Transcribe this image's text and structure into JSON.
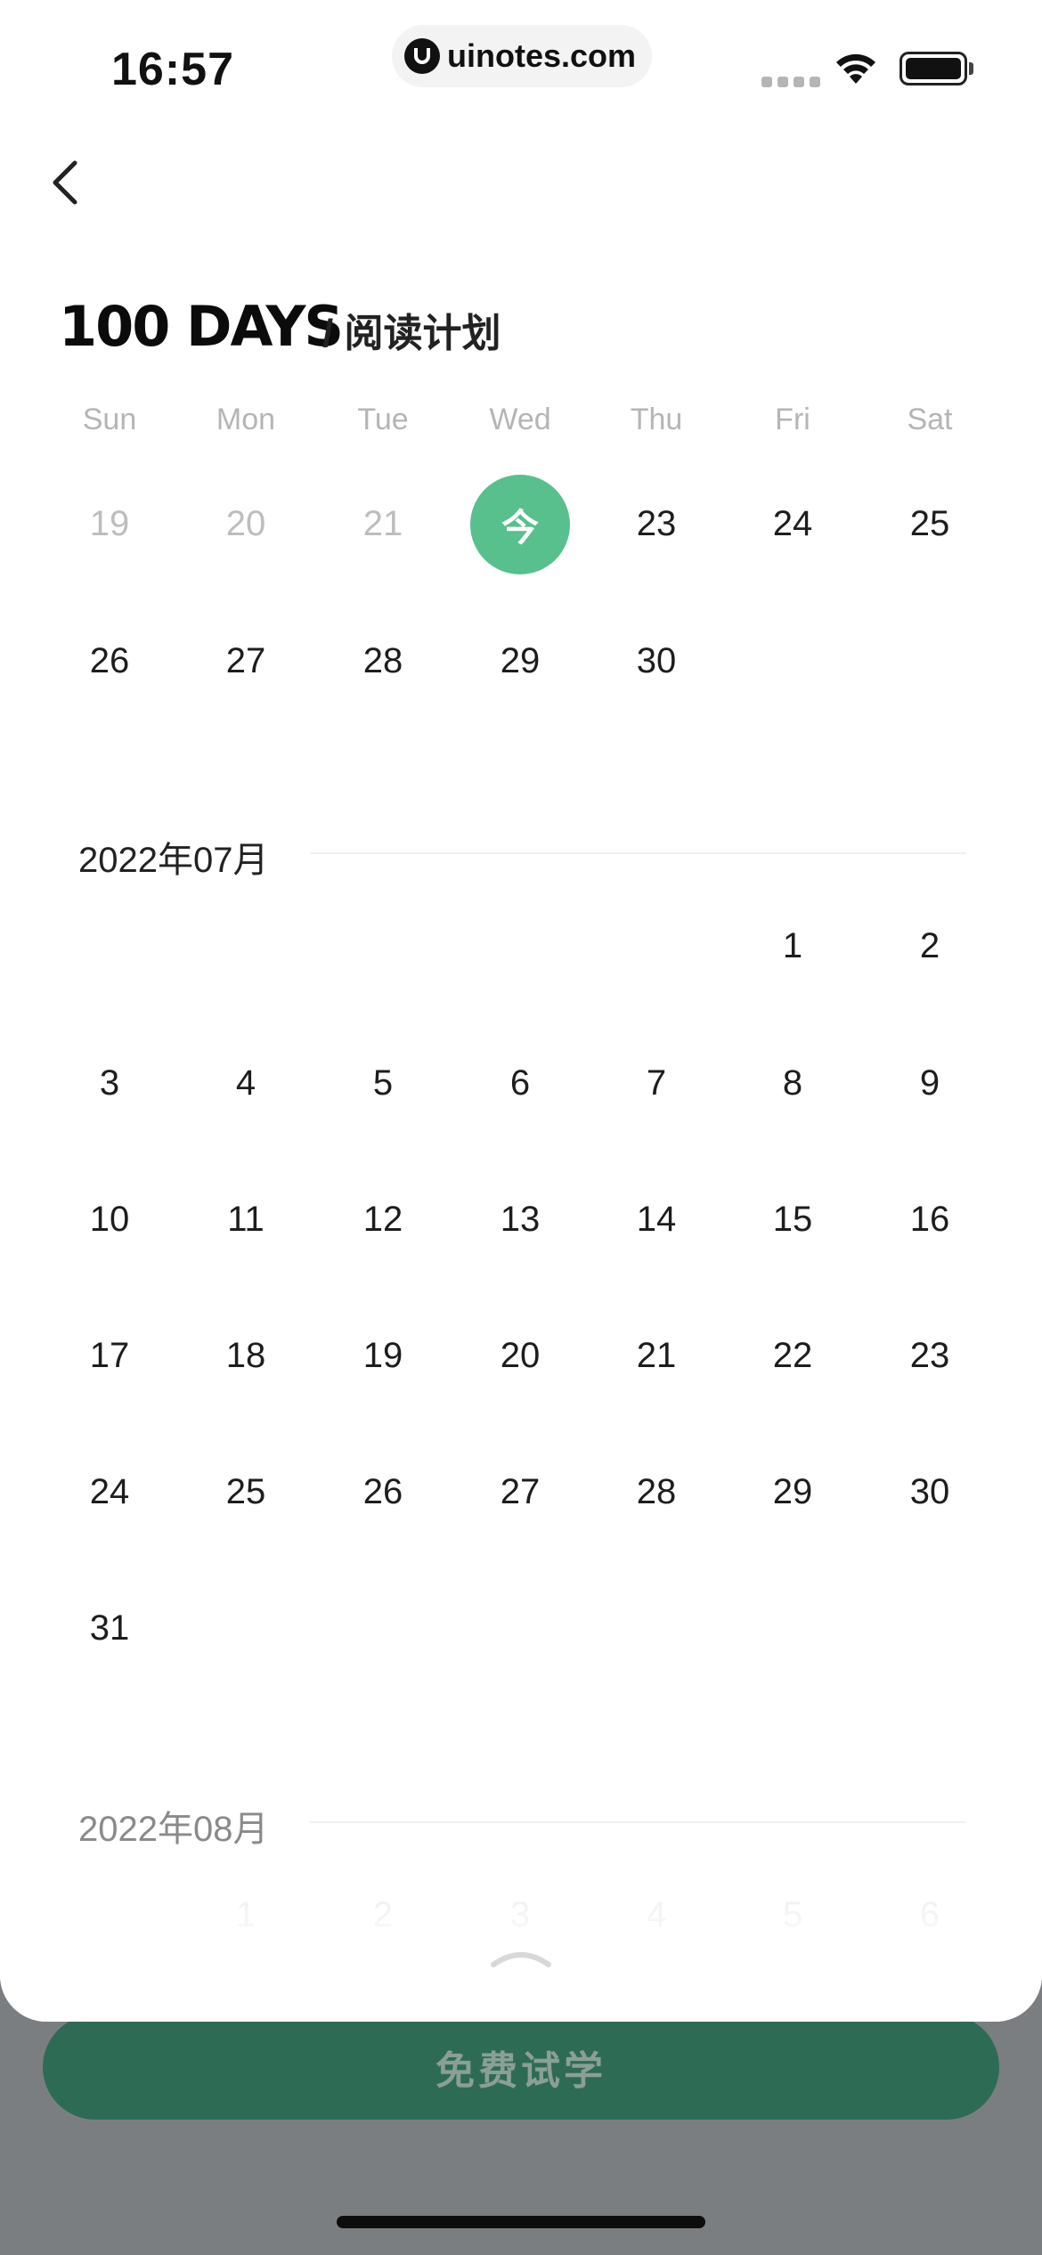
{
  "status_bar": {
    "time": "16:57",
    "url": "uinotes.com"
  },
  "header": {
    "brand": "100 DAYS",
    "title": "/ 阅读计划"
  },
  "weekdays": [
    "Sun",
    "Mon",
    "Tue",
    "Wed",
    "Thu",
    "Fri",
    "Sat"
  ],
  "june": {
    "row1": [
      "19",
      "20",
      "21",
      "今",
      "23",
      "24",
      "25"
    ],
    "row2": [
      "26",
      "27",
      "28",
      "29",
      "30"
    ]
  },
  "july": {
    "label": "2022年07月",
    "days": [
      "1",
      "2",
      "3",
      "4",
      "5",
      "6",
      "7",
      "8",
      "9",
      "10",
      "11",
      "12",
      "13",
      "14",
      "15",
      "16",
      "17",
      "18",
      "19",
      "20",
      "21",
      "22",
      "23",
      "24",
      "25",
      "26",
      "27",
      "28",
      "29",
      "30",
      "31"
    ]
  },
  "august": {
    "label": "2022年08月",
    "days": [
      "1",
      "2",
      "3",
      "4",
      "5",
      "6"
    ]
  },
  "cta": {
    "label": "免费试学"
  },
  "colors": {
    "accent": "#58c08d",
    "cta_bg": "#2d6b55"
  }
}
